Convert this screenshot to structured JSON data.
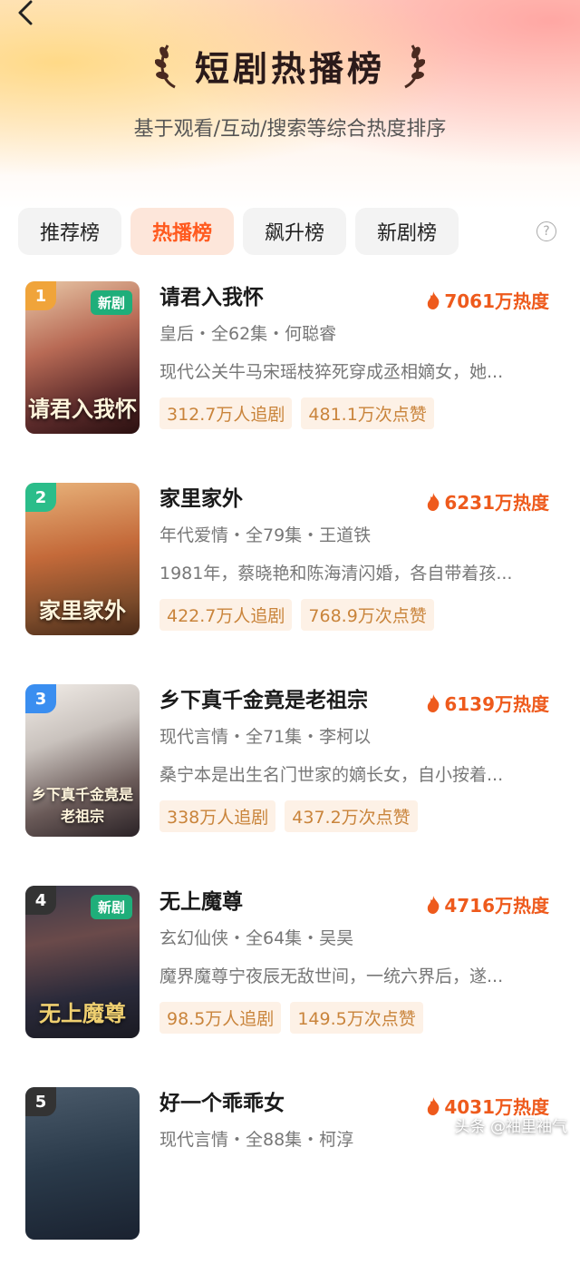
{
  "header": {
    "title": "短剧热播榜",
    "subtitle": "基于观看/互动/搜索等综合热度排序"
  },
  "tabs": [
    {
      "label": "推荐榜",
      "active": false
    },
    {
      "label": "热播榜",
      "active": true
    },
    {
      "label": "飙升榜",
      "active": false
    },
    {
      "label": "新剧榜",
      "active": false
    }
  ],
  "items": [
    {
      "rank": "1",
      "rank_color": "#f0a43a",
      "badge": "新剧",
      "poster_text": "请君入我怀",
      "name": "请君入我怀",
      "heat": "7061万热度",
      "meta": "皇后・全62集・何聪睿",
      "desc": "现代公关牛马宋瑶枝猝死穿成丞相嫡女，她...",
      "followers": "312.7万人追剧",
      "likes": "481.1万次点赞"
    },
    {
      "rank": "2",
      "rank_color": "#2bbd8a",
      "badge": "",
      "poster_text": "家里家外",
      "name": "家里家外",
      "heat": "6231万热度",
      "meta": "年代爱情・全79集・王道铁",
      "desc": "1981年，蔡晓艳和陈海清闪婚，各自带着孩...",
      "followers": "422.7万人追剧",
      "likes": "768.9万次点赞"
    },
    {
      "rank": "3",
      "rank_color": "#3a8ef0",
      "badge": "",
      "poster_text": "乡下真千金竟是老祖宗",
      "name": "乡下真千金竟是老祖宗",
      "heat": "6139万热度",
      "meta": "现代言情・全71集・李柯以",
      "desc": "桑宁本是出生名门世家的嫡长女，自小按着...",
      "followers": "338万人追剧",
      "likes": "437.2万次点赞"
    },
    {
      "rank": "4",
      "rank_color": "#333333",
      "badge": "新剧",
      "poster_text": "无上魔尊",
      "name": "无上魔尊",
      "heat": "4716万热度",
      "meta": "玄幻仙侠・全64集・吴昊",
      "desc": "魔界魔尊宁夜辰无敌世间，一统六界后，遂...",
      "followers": "98.5万人追剧",
      "likes": "149.5万次点赞"
    },
    {
      "rank": "5",
      "rank_color": "#333333",
      "badge": "",
      "poster_text": "",
      "name": "好一个乖乖女",
      "heat": "4031万热度",
      "meta": "现代言情・全88集・柯淳",
      "desc": "",
      "followers": "",
      "likes": ""
    }
  ],
  "watermark": "头条 @袖里袖气",
  "colors": {
    "accent": "#ee5a1c",
    "badge_green": "#1fae7a"
  }
}
